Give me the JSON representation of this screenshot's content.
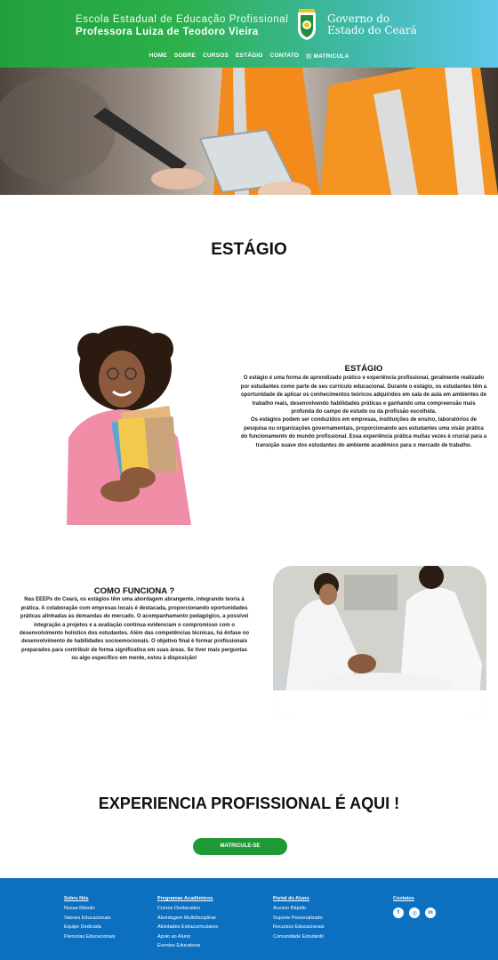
{
  "header": {
    "school_line1": "Escola Estadual de Educação Profissional",
    "school_line2": "Professora Luiza de Teodoro Vieira",
    "gov_line1": "Governo do",
    "gov_line2": "Estado do Ceará",
    "nav": [
      "HOME",
      "SOBRE",
      "CURSOS",
      "ESTÁGIO",
      "CONTATO",
      "MATRICULA"
    ]
  },
  "page_title": "ESTÁGIO",
  "estagio": {
    "heading": "ESTÁGIO",
    "p1": "O estágio é uma forma de aprendizado prático e experiência profissional, geralmente realizado por estudantes como parte de seu currículo educacional. Durante o estágio, os estudantes têm a oportunidade de aplicar os conhecimentos teóricos adquiridos em sala de aula em ambientes de trabalho reais, desenvolvendo habilidades práticas e ganhando uma compreensão mais profunda do campo de estudo ou da profissão escolhida.",
    "p2": "Os estágios podem ser conduzidos em empresas, instituições de ensino, laboratórios de pesquisa ou organizações governamentais, proporcionando aos estudantes uma visão prática do funcionamento do mundo profissional. Essa experiência prática muitas vezes é crucial para a transição suave dos estudantes do ambiente acadêmico para o mercado de trabalho."
  },
  "como": {
    "heading": "COMO FUNCIONA ?",
    "text": "Nas EEEPs do Ceará, os estágios têm uma abordagem abrangente, integrando teoria à prática. A colaboração com empresas locais é destacada, proporcionando oportunidades práticas alinhadas às demandas do mercado. O acompanhamento pedagógico, a possível integração a projetos e a avaliação contínua evidenciam o compromisso com o desenvolvimento holístico dos estudantes. Além das competências técnicas, há ênfase no desenvolvimento de habilidades socioemocionais. O objetivo final é formar profissionais preparados para contribuir de forma significativa em suas áreas. Se tiver mais perguntas ou algo específico em mente, estou à disposição!"
  },
  "cta": {
    "title": "EXPERIENCIA PROFISSIONAL É AQUI !",
    "button": "MATRICULE-SE"
  },
  "footer": {
    "col1": {
      "title": "Sobre Nós",
      "items": [
        "Nossa Missão",
        "Valores Educacionais",
        "Equipe Dedicada",
        "Parcerias Educacionais"
      ]
    },
    "col2": {
      "title": "Programas Acadêmicos",
      "items": [
        "Cursos Destacados",
        "Abordagem Multidisciplinar",
        "Atividades Extracurriculares",
        "Apoio ao Aluno",
        "Eventos Educativos"
      ]
    },
    "col3": {
      "title": "Portal do Aluno",
      "items": [
        "Acesso Rápido",
        "Suporte Personalizado",
        "Recursos Educacionais",
        "Comunidade Estudantil"
      ]
    },
    "col4": {
      "title": "Contatos"
    }
  }
}
